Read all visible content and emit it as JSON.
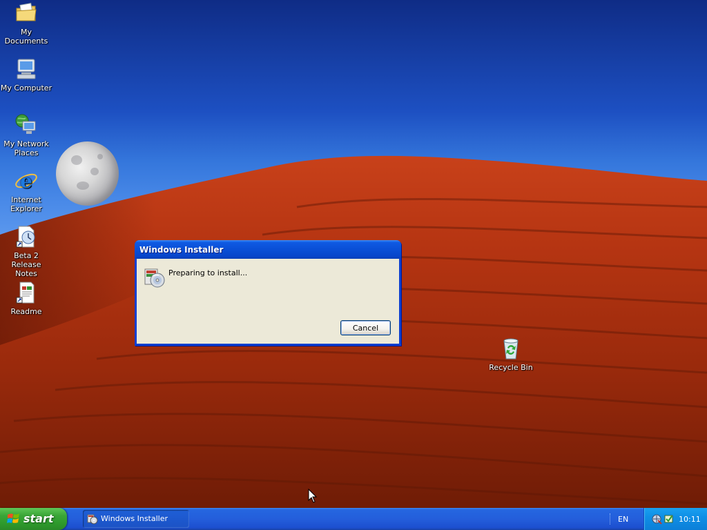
{
  "desktop": {
    "icons": [
      {
        "label": "My Documents",
        "icon": "folder-icon"
      },
      {
        "label": "My Computer",
        "icon": "computer-icon"
      },
      {
        "label": "My Network Places",
        "icon": "network-icon"
      },
      {
        "label": "Internet Explorer",
        "icon": "internet-explorer-icon"
      },
      {
        "label": "Beta 2 Release Notes",
        "icon": "release-notes-icon"
      },
      {
        "label": "Readme",
        "icon": "readme-icon"
      },
      {
        "label": "Recycle Bin",
        "icon": "recycle-bin-icon"
      }
    ]
  },
  "dialog": {
    "title": "Windows Installer",
    "message": "Preparing to install...",
    "cancel_label": "Cancel",
    "icon": "installer-icon"
  },
  "taskbar": {
    "start_label": "start",
    "tasks": [
      {
        "label": "Windows Installer",
        "icon": "installer-icon"
      }
    ],
    "language": "EN",
    "clock": "10:11",
    "tray_icons": [
      "network-tray-icon",
      "security-tray-icon"
    ]
  },
  "colors": {
    "titlebar": "#0a4fd6",
    "dialog_bg": "#ece9d8",
    "taskbar": "#245edb",
    "start_green": "#3aa537",
    "tray": "#0f8fe6"
  }
}
